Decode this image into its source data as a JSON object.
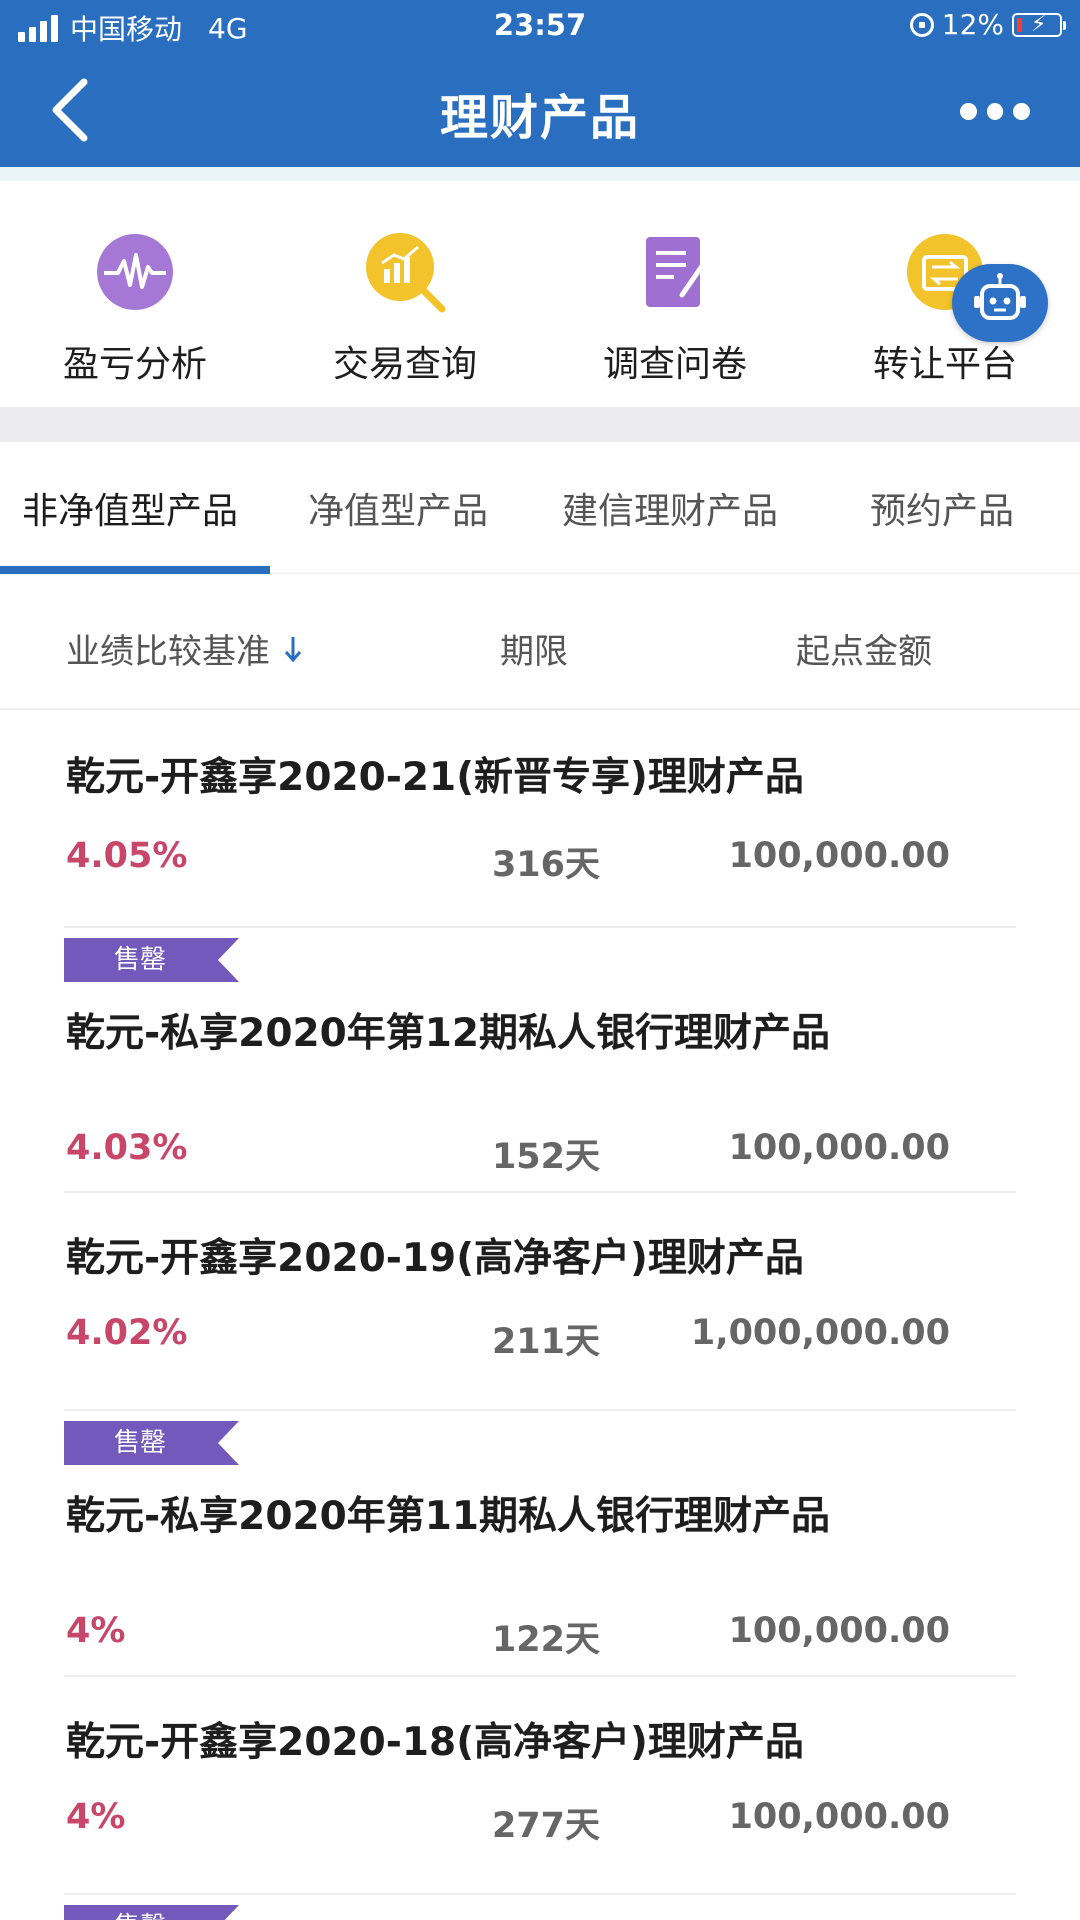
{
  "status_bar": {
    "carrier": "中国移动",
    "network": "4G",
    "time": "23:57",
    "battery": "12%"
  },
  "nav": {
    "title": "理财产品"
  },
  "quick_menu": [
    {
      "label": "盈亏分析",
      "icon": "pulse-icon",
      "color": "#a678d6"
    },
    {
      "label": "交易查询",
      "icon": "chart-search-icon",
      "color": "#f2c32a"
    },
    {
      "label": "调查问卷",
      "icon": "survey-icon",
      "color": "#9f6fd2"
    },
    {
      "label": "转让平台",
      "icon": "transfer-icon",
      "color": "#f2c32a"
    }
  ],
  "tabs": [
    {
      "label": "非净值型产品",
      "active": true
    },
    {
      "label": "净值型产品",
      "active": false
    },
    {
      "label": "建信理财产品",
      "active": false
    },
    {
      "label": "预约产品",
      "active": false
    }
  ],
  "columns": {
    "rate": "业绩比较基准",
    "term": "期限",
    "amount": "起点金额"
  },
  "products": [
    {
      "tag": "",
      "name": "乾元-开鑫享2020-21(新晋专享)理财产品",
      "rate": "4.05%",
      "term": "316天",
      "amount": "100,000.00"
    },
    {
      "tag": "售罄",
      "name": "乾元-私享2020年第12期私人银行理财产品",
      "rate": "4.03%",
      "term": "152天",
      "amount": "100,000.00"
    },
    {
      "tag": "",
      "name": "乾元-开鑫享2020-19(高净客户)理财产品",
      "rate": "4.02%",
      "term": "211天",
      "amount": "1,000,000.00"
    },
    {
      "tag": "售罄",
      "name": "乾元-私享2020年第11期私人银行理财产品",
      "rate": "4%",
      "term": "122天",
      "amount": "100,000.00"
    },
    {
      "tag": "",
      "name": "乾元-开鑫享2020-18(高净客户)理财产品",
      "rate": "4%",
      "term": "277天",
      "amount": "100,000.00"
    },
    {
      "tag": "售罄",
      "name": "",
      "rate": "",
      "term": "",
      "amount": ""
    }
  ],
  "colors": {
    "primary": "#2a6ec0",
    "rate_text": "#c8466a",
    "sold_out_tag": "#7259bb"
  }
}
